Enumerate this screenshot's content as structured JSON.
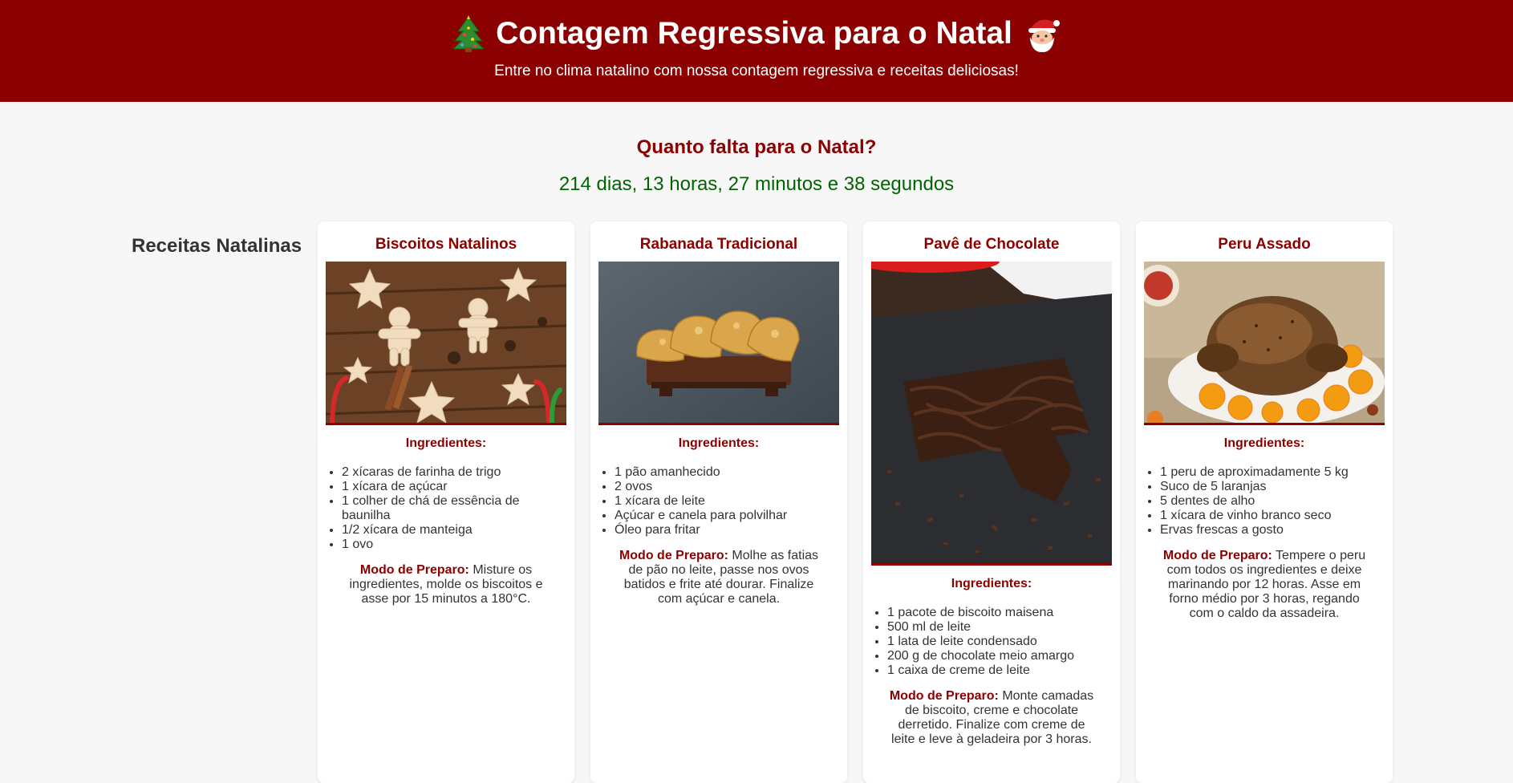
{
  "header": {
    "title": "Contagem Regressiva para o Natal",
    "subtitle": "Entre no clima natalino com nossa contagem regressiva e receitas deliciosas!",
    "tree_icon": "christmas-tree-emoji",
    "santa_icon": "santa-emoji"
  },
  "countdown": {
    "heading": "Quanto falta para o Natal?",
    "time": "214 dias, 13 horas, 27 minutos e 38 segundos"
  },
  "recipes_section": {
    "heading": "Receitas Natalinas",
    "ingredients_label": "Ingredientes:",
    "method_label": "Modo de Preparo:"
  },
  "recipes": [
    {
      "title": "Biscoitos Natalinos",
      "ingredients": [
        "2 xícaras de farinha de trigo",
        "1 xícara de açúcar",
        "1 colher de chá de essência de baunilha",
        "1/2 xícara de manteiga",
        "1 ovo"
      ],
      "method": "Misture os ingredientes, molde os biscoitos e asse por 15 minutos a 180°C."
    },
    {
      "title": "Rabanada Tradicional",
      "ingredients": [
        "1 pão amanhecido",
        "2 ovos",
        "1 xícara de leite",
        "Açúcar e canela para polvilhar",
        "Óleo para fritar"
      ],
      "method": "Molhe as fatias de pão no leite, passe nos ovos batidos e frite até dourar. Finalize com açúcar e canela."
    },
    {
      "title": "Pavê de Chocolate",
      "ingredients": [
        "1 pacote de biscoito maisena",
        "500 ml de leite",
        "1 lata de leite condensado",
        "200 g de chocolate meio amargo",
        "1 caixa de creme de leite"
      ],
      "method": "Monte camadas de biscoito, creme e chocolate derretido. Finalize com creme de leite e leve à geladeira por 3 horas."
    },
    {
      "title": "Peru Assado",
      "ingredients": [
        "1 peru de aproximadamente 5 kg",
        "Suco de 5 laranjas",
        "5 dentes de alho",
        "1 xícara de vinho branco seco",
        "Ervas frescas a gosto"
      ],
      "method": "Tempere o peru com todos os ingredientes e deixe marinando por 12 horas. Asse em forno médio por 3 horas, regando com o caldo da assadeira."
    }
  ],
  "colors": {
    "header_bg": "#8b0000",
    "accent": "#8b0000",
    "timer": "#006400",
    "page_bg": "#f7f7f7"
  }
}
